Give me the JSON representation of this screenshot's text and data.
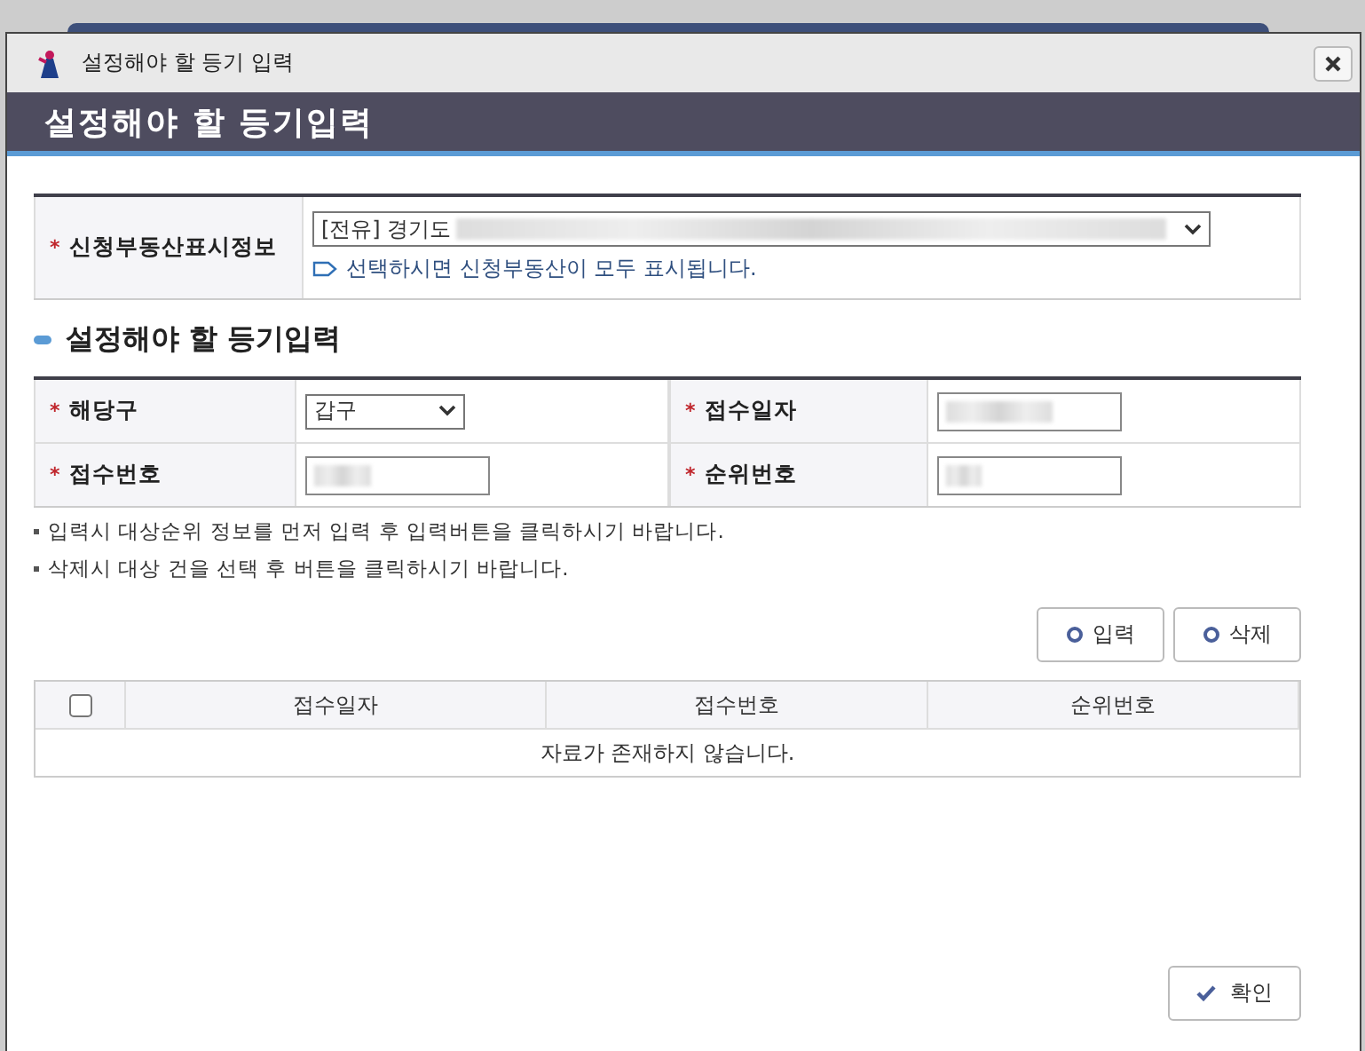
{
  "dialog": {
    "title": "설정해야 할 등기 입력",
    "header": "설정해야 할 등기입력"
  },
  "property": {
    "marker": "*",
    "label": "신청부동산표시정보",
    "value": "[전유] 경기도",
    "masked": true,
    "hint": "선택하시면 신청부동산이 모두 표시됩니다."
  },
  "section_title": "설정해야 할 등기입력",
  "fields": [
    {
      "marker": "*",
      "label": "해당구",
      "kind": "select",
      "value": "갑구"
    },
    {
      "marker": "*",
      "label": "접수일자",
      "kind": "input",
      "masked": true
    },
    {
      "marker": "*",
      "label": "접수번호",
      "kind": "input",
      "masked": true
    },
    {
      "marker": "*",
      "label": "순위번호",
      "kind": "input",
      "masked": true
    }
  ],
  "notes": [
    "입력시 대상순위 정보를 먼저 입력 후 입력버튼을 클릭하시기 바랍니다.",
    "삭제시 대상 건을 선택 후 버튼을 클릭하시기 바랍니다."
  ],
  "actions": [
    {
      "label": "입력"
    },
    {
      "label": "삭제"
    }
  ],
  "table": {
    "select_all": {
      "checked": false
    },
    "columns": [
      "접수일자",
      "접수번호",
      "순위번호"
    ],
    "empty_message": "자료가 존재하지 않습니다."
  },
  "confirm": {
    "label": "확인"
  }
}
